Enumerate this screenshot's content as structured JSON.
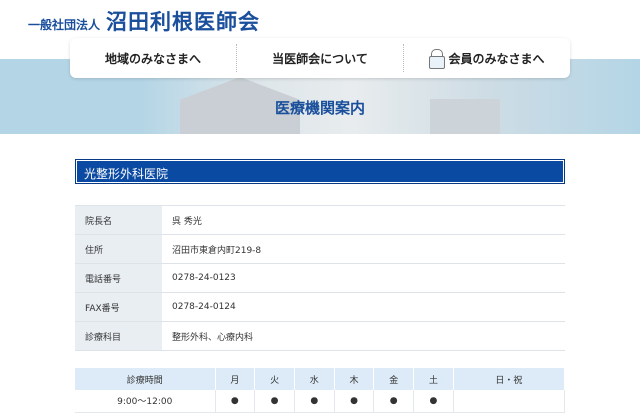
{
  "header": {
    "org_prefix": "一般社団法人",
    "org_name": "沼田利根医師会"
  },
  "nav": [
    {
      "label": "地域のみなさまへ"
    },
    {
      "label": "当医師会について"
    },
    {
      "label": "会員のみなさまへ",
      "icon": "lock-icon"
    }
  ],
  "page_title": "医療機関案内",
  "clinic": {
    "name": "光整形外科医院",
    "info": [
      {
        "label": "院長名",
        "value": "呉 秀光"
      },
      {
        "label": "住所",
        "value": "沼田市東倉内町219-8"
      },
      {
        "label": "電話番号",
        "value": "0278-24-0123"
      },
      {
        "label": "FAX番号",
        "value": "0278-24-0124"
      },
      {
        "label": "診療科目",
        "value": "整形外科、心療内科"
      }
    ]
  },
  "hours": {
    "headers": [
      "診療時間",
      "月",
      "火",
      "水",
      "木",
      "金",
      "土",
      "日・祝"
    ],
    "rows": [
      {
        "time": "9:00～12:00",
        "marks": [
          "●",
          "●",
          "●",
          "●",
          "●",
          "●",
          ""
        ]
      }
    ]
  }
}
